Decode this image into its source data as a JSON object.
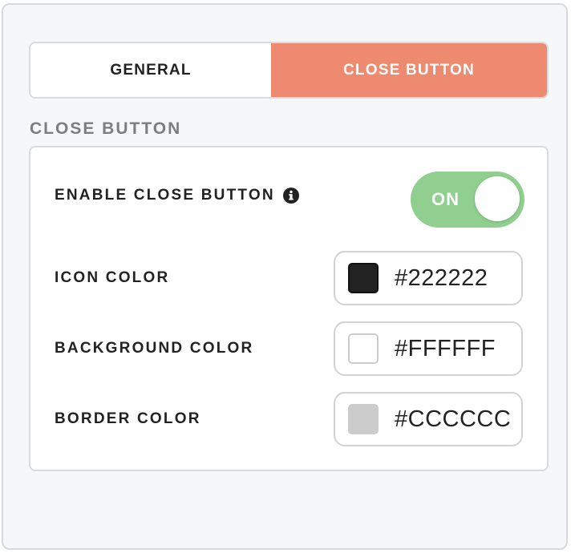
{
  "tabs": [
    {
      "label": "GENERAL",
      "active": false
    },
    {
      "label": "CLOSE BUTTON",
      "active": true
    }
  ],
  "section": {
    "title": "CLOSE BUTTON"
  },
  "enable_close": {
    "label": "ENABLE CLOSE BUTTON",
    "info_icon": "info-icon",
    "toggle_text": "ON",
    "state": "on"
  },
  "icon_color": {
    "label": "ICON COLOR",
    "value": "#222222",
    "swatch": "#222222"
  },
  "background_color": {
    "label": "BACKGROUND COLOR",
    "value": "#FFFFFF",
    "swatch": "#FFFFFF"
  },
  "border_color": {
    "label": "BORDER COLOR",
    "value": "#CCCCCC",
    "swatch": "#CCCCCC"
  },
  "colors": {
    "accent_tab": "#ee8a6f",
    "toggle_on": "#90cf8f",
    "panel_bg": "#f6f7f9"
  }
}
